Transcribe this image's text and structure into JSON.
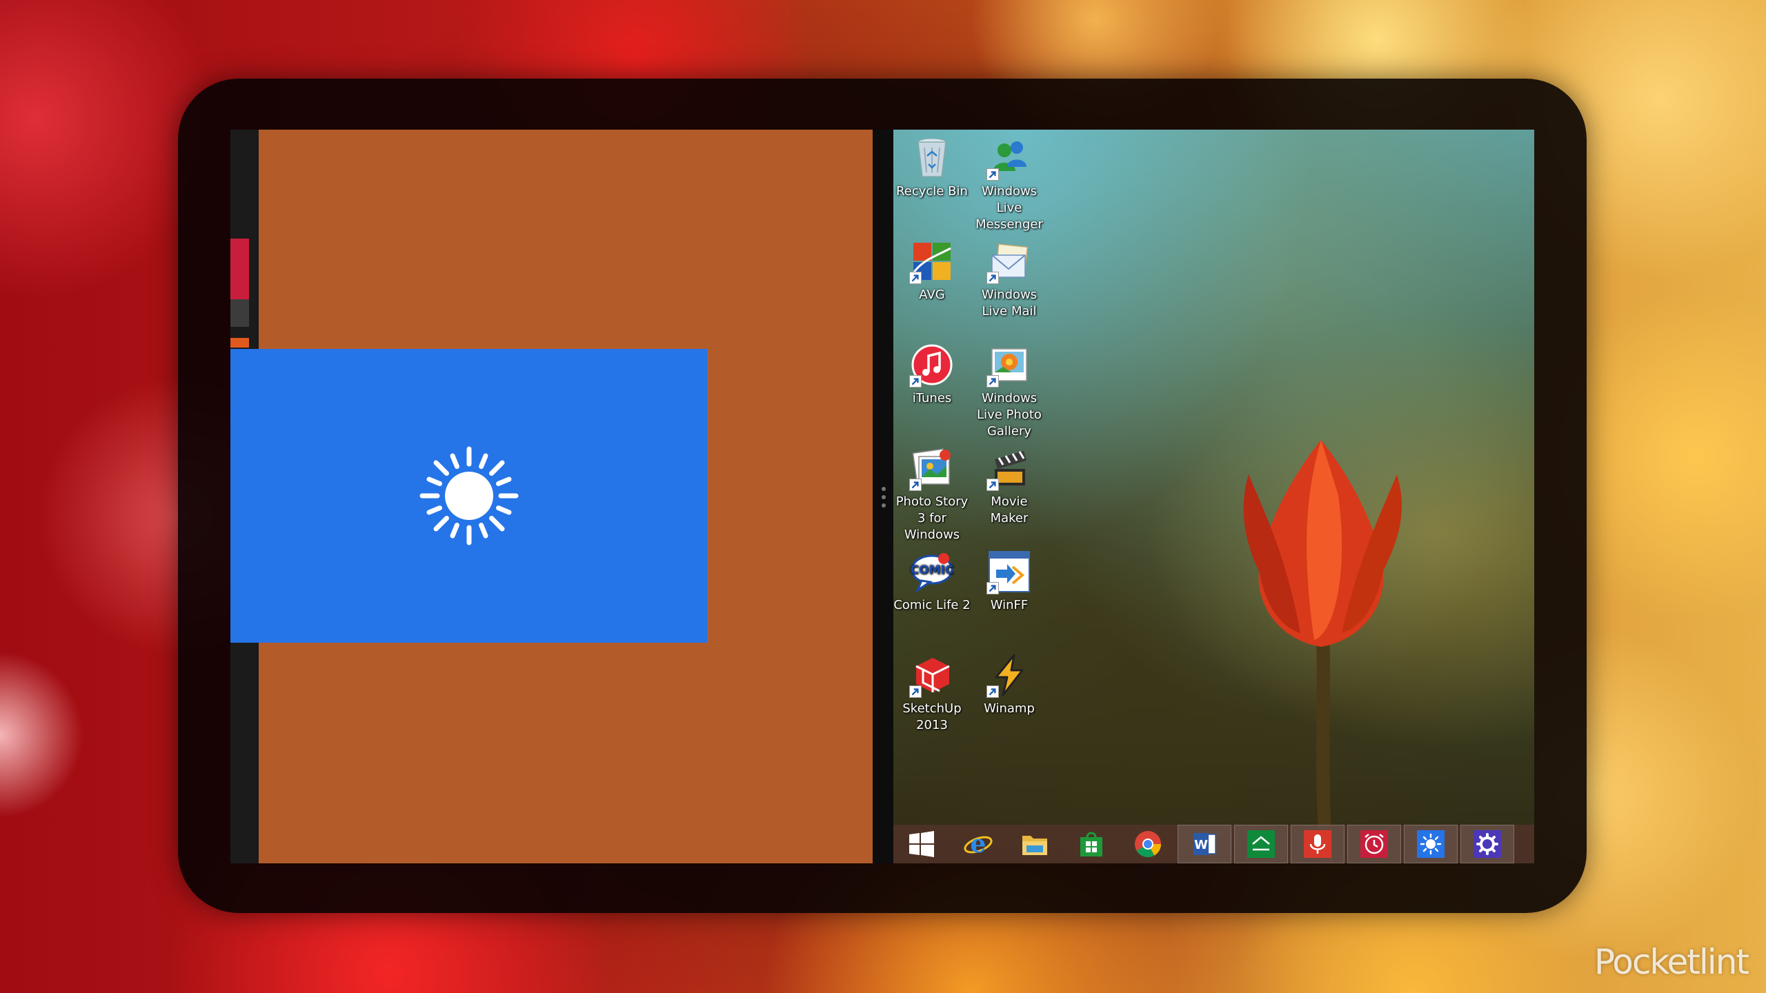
{
  "desktop_icons": {
    "recycle_bin": "Recycle Bin",
    "wl_messenger": "Windows Live Messenger",
    "avg": "AVG",
    "wl_mail": "Windows Live Mail",
    "itunes": "iTunes",
    "wl_photo": "Windows Live Photo Gallery",
    "photo_story": "Photo Story 3 for Windows",
    "movie_maker": "Movie Maker",
    "comic_life": "Comic Life 2",
    "winff": "WinFF",
    "sketchup": "SketchUp 2013",
    "winamp": "Winamp"
  },
  "taskbar": {
    "items": [
      "start-icon",
      "internet-explorer-icon",
      "file-explorer-icon",
      "store-icon",
      "chrome-icon",
      "word-icon",
      "finance-icon",
      "sound-recorder-icon",
      "alarms-icon",
      "weather-icon",
      "settings-icon"
    ]
  },
  "colors": {
    "weather_tile": "#2574e8",
    "snap_pane": "#b35c2a"
  },
  "watermark": "Pocketlint"
}
